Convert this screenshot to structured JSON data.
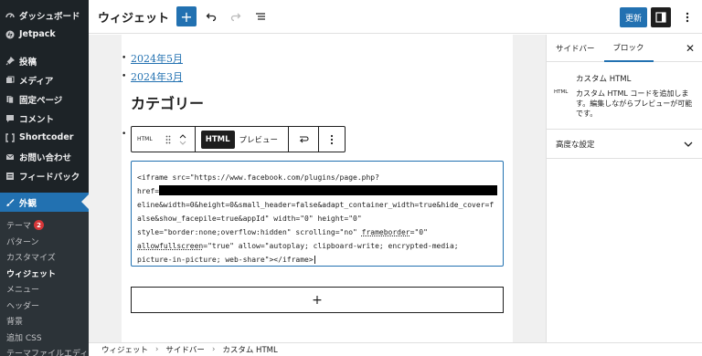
{
  "admin_menu": {
    "items": [
      {
        "label": "ダッシュボード",
        "icon": "dashboard-icon"
      },
      {
        "label": "Jetpack",
        "icon": "jetpack-icon"
      },
      {
        "label": "投稿",
        "icon": "pin-icon"
      },
      {
        "label": "メディア",
        "icon": "media-icon"
      },
      {
        "label": "固定ページ",
        "icon": "page-icon"
      },
      {
        "label": "コメント",
        "icon": "comment-icon"
      },
      {
        "label": "Shortcoder",
        "icon": "shortcode-icon"
      },
      {
        "label": "お問い合わせ",
        "icon": "mail-icon"
      },
      {
        "label": "フィードバック",
        "icon": "feedback-icon"
      },
      {
        "label": "外観",
        "icon": "appearance-icon"
      }
    ],
    "submenu": [
      {
        "label": "テーマ",
        "badge": "2"
      },
      {
        "label": "パターン"
      },
      {
        "label": "カスタマイズ"
      },
      {
        "label": "ウィジェット"
      },
      {
        "label": "メニュー"
      },
      {
        "label": "ヘッダー"
      },
      {
        "label": "背景"
      },
      {
        "label": "追加 CSS"
      },
      {
        "label": "テーマファイルエディ"
      }
    ]
  },
  "header": {
    "title": "ウィジェット",
    "save_label": "更新"
  },
  "content": {
    "links": [
      "2024年5月",
      "2024年3月"
    ],
    "heading": "カテゴリー",
    "toolbar": {
      "block_label": "HTML",
      "mode_html": "HTML",
      "mode_preview": "プレビュー"
    },
    "code": {
      "line1": "<iframe src=\"https://www.facebook.com/plugins/page.php?",
      "line2_prefix": "href=",
      "line3": "eline&width=0&height=0&small_header=false&adapt_container_width=true&hide_cover=f",
      "line4": "alse&show_facepile=true&appId\" width=\"0\" height=\"0\"",
      "line5a": "style=\"border:none;overflow:hidden\" scrolling=\"no\" ",
      "line5b": "frameborder",
      "line5c": "=\"0\"",
      "line6a": "allowfullscreen",
      "line6b": "=\"true\" allow=\"autoplay; clipboard-write; encrypted-media;",
      "line7": "picture-in-picture; web-share\"></iframe>"
    },
    "appender_label": "+"
  },
  "panel": {
    "tabs": [
      "サイドバー",
      "ブロック"
    ],
    "block_name": "カスタム HTML",
    "block_icon_label": "HTML",
    "block_description": "カスタム HTML コードを追加しま す。編集しながらプレビューが可能 です。",
    "advanced_label": "高度な設定"
  },
  "breadcrumb": [
    "ウィジェット",
    "サイドバー",
    "カスタム HTML"
  ],
  "colors": {
    "admin_bg": "#1d2327",
    "accent": "#2271b1",
    "badge": "#d63638"
  }
}
